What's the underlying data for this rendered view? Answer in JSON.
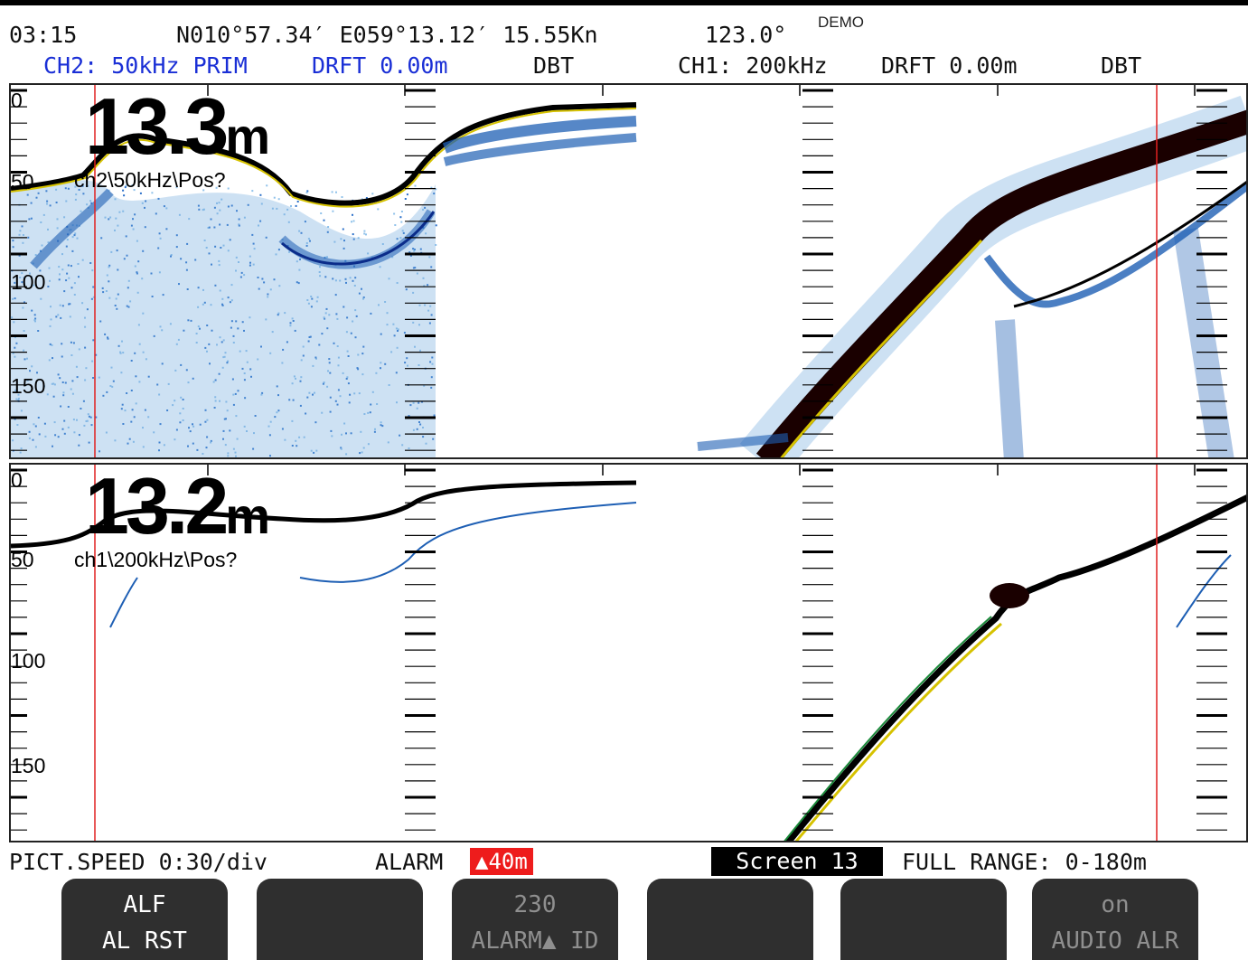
{
  "header": {
    "time": "03:15",
    "position": "N010°57.34′ E059°13.12′ 15.55Kn",
    "heading": "123.0°",
    "mode": "DEMO",
    "ch2": {
      "label": "CH2: 50kHz PRIM",
      "draft": "DRFT 0.00m",
      "ref": "DBT"
    },
    "ch1": {
      "label": "CH1: 200kHz",
      "draft": "DRFT 0.00m",
      "ref": "DBT"
    }
  },
  "panel_top": {
    "depth_value": "13.3",
    "depth_unit": "m",
    "channel_label": "ch2\\50kHz\\Pos?",
    "depth_labels": [
      "0",
      "50",
      "100",
      "150"
    ]
  },
  "panel_bottom": {
    "depth_value": "13.2",
    "depth_unit": "m",
    "channel_label": "ch1\\200kHz\\Pos?",
    "depth_labels": [
      "0",
      "50",
      "100",
      "150"
    ]
  },
  "status": {
    "pict_speed": "PICT.SPEED 0:30/div",
    "alarm_label": "ALARM",
    "alarm_value": "▲40m",
    "screen": "Screen 13",
    "range": "FULL RANGE: 0-180m"
  },
  "softkeys": [
    {
      "line1": "ALF",
      "line2": "AL RST",
      "enabled": true
    },
    {
      "line1": "",
      "line2": "",
      "enabled": true
    },
    {
      "line1": "230",
      "line2": "ALARM▲ ID",
      "enabled": false
    },
    {
      "line1": "",
      "line2": "",
      "enabled": true
    },
    {
      "line1": "",
      "line2": "",
      "enabled": true
    },
    {
      "line1": "on",
      "line2": "AUDIO ALR",
      "enabled": false
    }
  ],
  "colors": {
    "accent_blue": "#1a2fd6",
    "alarm_red": "#ee1c1c",
    "softkey_bg": "#2f2f2f",
    "marker_red": "#e02020"
  }
}
